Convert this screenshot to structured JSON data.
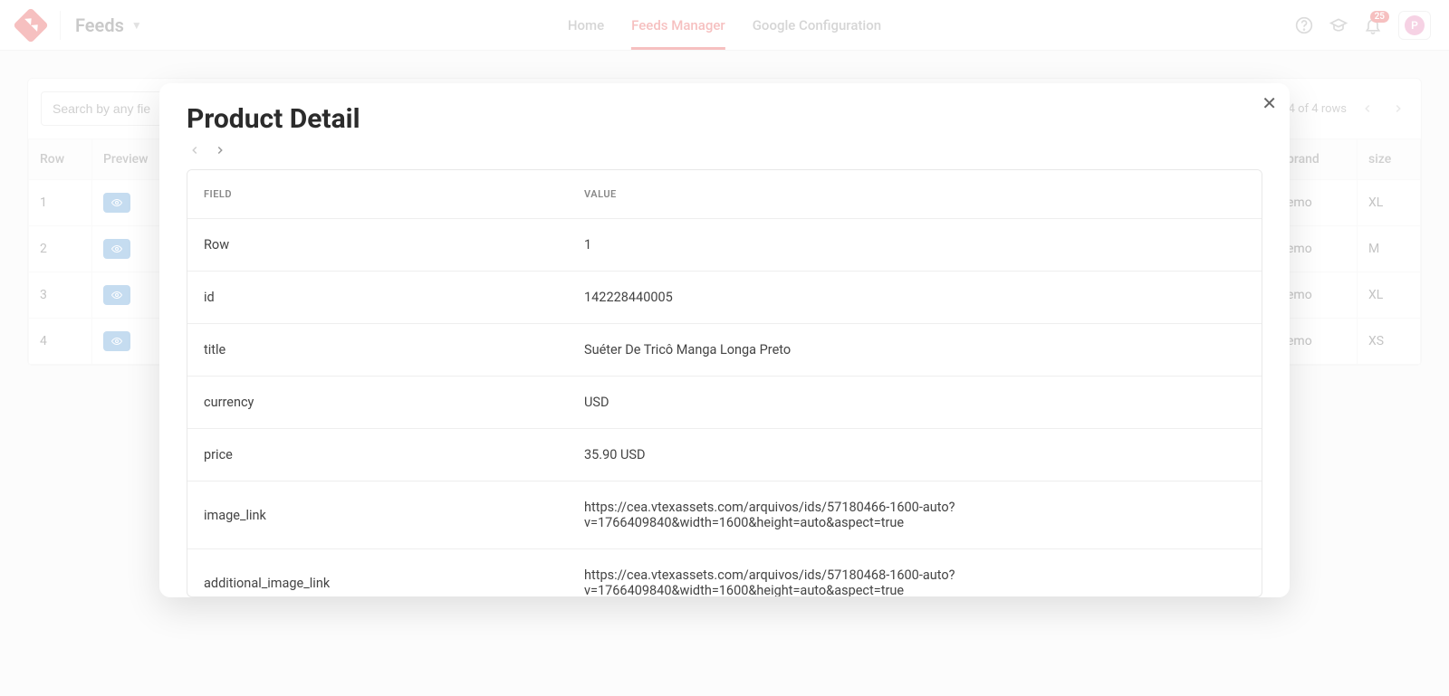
{
  "topbar": {
    "feeds_label": "Feeds",
    "notif_count": "25",
    "avatar_letter": "P"
  },
  "nav": {
    "home": "Home",
    "feeds_manager": "Feeds Manager",
    "google_config": "Google Configuration"
  },
  "panel": {
    "search_placeholder": "Search by any fie",
    "pag_text": "-4 of 4 rows"
  },
  "bg_table": {
    "headers": {
      "row": "Row",
      "preview": "Preview",
      "brand": "brand",
      "size": "size"
    },
    "rows": [
      {
        "row": "1",
        "brand": "emo",
        "size": "XL"
      },
      {
        "row": "2",
        "brand": "emo",
        "size": "M"
      },
      {
        "row": "3",
        "brand": "emo",
        "size": "XL"
      },
      {
        "row": "4",
        "brand": "emo",
        "size": "XS"
      }
    ]
  },
  "modal": {
    "title": "Product Detail",
    "headers": {
      "field": "FIELD",
      "value": "VALUE"
    },
    "rows": [
      {
        "field": "Row",
        "value": "1"
      },
      {
        "field": "id",
        "value": "142228440005"
      },
      {
        "field": "title",
        "value": "Suéter De Tricô Manga Longa Preto"
      },
      {
        "field": "currency",
        "value": "USD"
      },
      {
        "field": "price",
        "value": "35.90 USD"
      },
      {
        "field": "image_link",
        "value": "https://cea.vtexassets.com/arquivos/ids/57180466-1600-auto?v=1766409840&width=1600&height=auto&aspect=true"
      },
      {
        "field": "additional_image_link",
        "value": "https://cea.vtexassets.com/arquivos/ids/57180468-1600-auto?v=1766409840&width=1600&height=auto&aspect=true"
      }
    ]
  }
}
